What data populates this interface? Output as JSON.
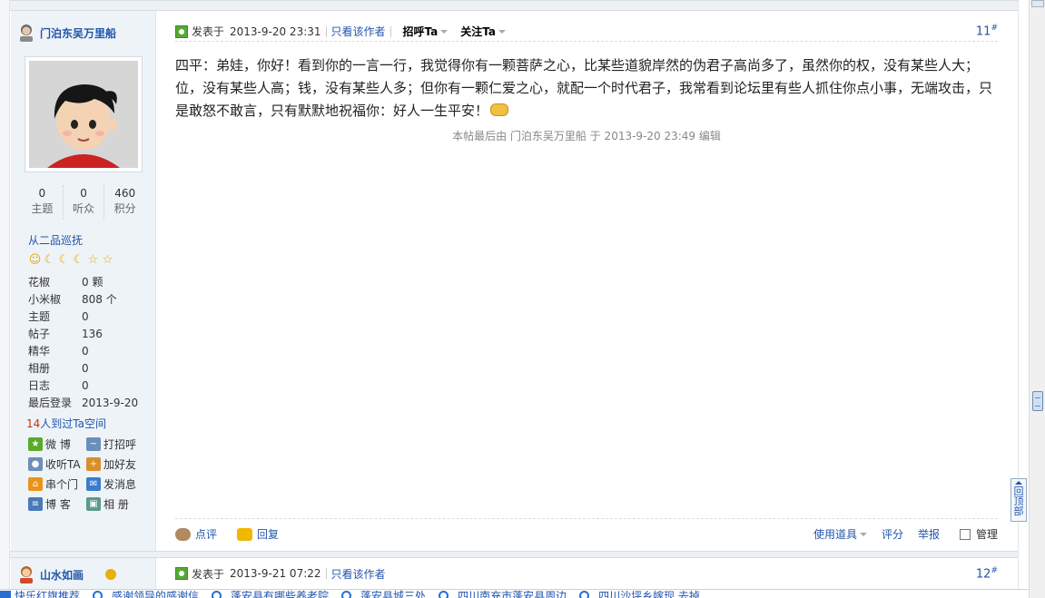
{
  "post1": {
    "author": "门泊东吴万里船",
    "stats": [
      {
        "value": "0",
        "label": "主题"
      },
      {
        "value": "0",
        "label": "听众"
      },
      {
        "value": "460",
        "label": "积分"
      }
    ],
    "rank_title": "从二品巡抚",
    "props": [
      {
        "k": "花椒",
        "v": "0 颗"
      },
      {
        "k": "小米椒",
        "v": "808 个"
      },
      {
        "k": "主题",
        "v": "0"
      },
      {
        "k": "帖子",
        "v": "136"
      },
      {
        "k": "精华",
        "v": "0"
      },
      {
        "k": "相册",
        "v": "0"
      },
      {
        "k": "日志",
        "v": "0"
      },
      {
        "k": "最后登录",
        "v": "2013-9-20"
      }
    ],
    "visits_count": "14",
    "visits_text": "人到过Ta空间",
    "actions": [
      {
        "label": "微  博",
        "icon": "weibo-icon",
        "color": "#5aaa2a"
      },
      {
        "label": "打招呼",
        "icon": "wave-icon",
        "color": "#6b8fb8"
      },
      {
        "label": "收听TA",
        "icon": "listen-icon",
        "color": "#6b8fb8"
      },
      {
        "label": "加好友",
        "icon": "add-friend-icon",
        "color": "#d88e2a"
      },
      {
        "label": "串个门",
        "icon": "home-icon",
        "color": "#e8941a"
      },
      {
        "label": "发消息",
        "icon": "message-icon",
        "color": "#3a7ccc"
      },
      {
        "label": "博  客",
        "icon": "blog-icon",
        "color": "#4a7ab8"
      },
      {
        "label": "相  册",
        "icon": "album-icon",
        "color": "#5a9a8a"
      }
    ],
    "posted_label": "发表于",
    "posted_date": "2013-9-20 23:31",
    "only_author": "只看该作者",
    "greet": "招呼Ta",
    "follow": "关注Ta",
    "floor": "11",
    "floor_mark": "#",
    "body": "四平：弟娃，你好！看到你的一言一行，我觉得你有一颗菩萨之心，比某些道貌岸然的伪君子高尚多了，虽然你的权，没有某些人大；位，没有某些人高；钱，没有某些人多；但你有一颗仁爱之心，就配一个时代君子，我常看到论坛里有些人抓住你点小事，无端攻击，只是敢怒不敢言，只有默默地祝福你：好人一生平安！",
    "edit_note": "本帖最后由 门泊东吴万里船 于 2013-9-20 23:49 编辑",
    "footer": {
      "comment": "点评",
      "reply": "回复",
      "use_tool": "使用道具",
      "rate": "评分",
      "report": "举报",
      "manage": "管理"
    }
  },
  "post2": {
    "author": "山水如画",
    "posted_label": "发表于",
    "posted_date": "2013-9-21 07:22",
    "only_author": "只看该作者",
    "floor": "12",
    "floor_mark": "#"
  },
  "totop": "回顶部",
  "bottom_links": [
    "快乐红旗推荐",
    "感谢领导的感谢信",
    "蓬安县有哪些养老院",
    "蓬安县城三处",
    "四川南充市蓬安县周边",
    "四川沙坪乡嫁现 去掉"
  ]
}
